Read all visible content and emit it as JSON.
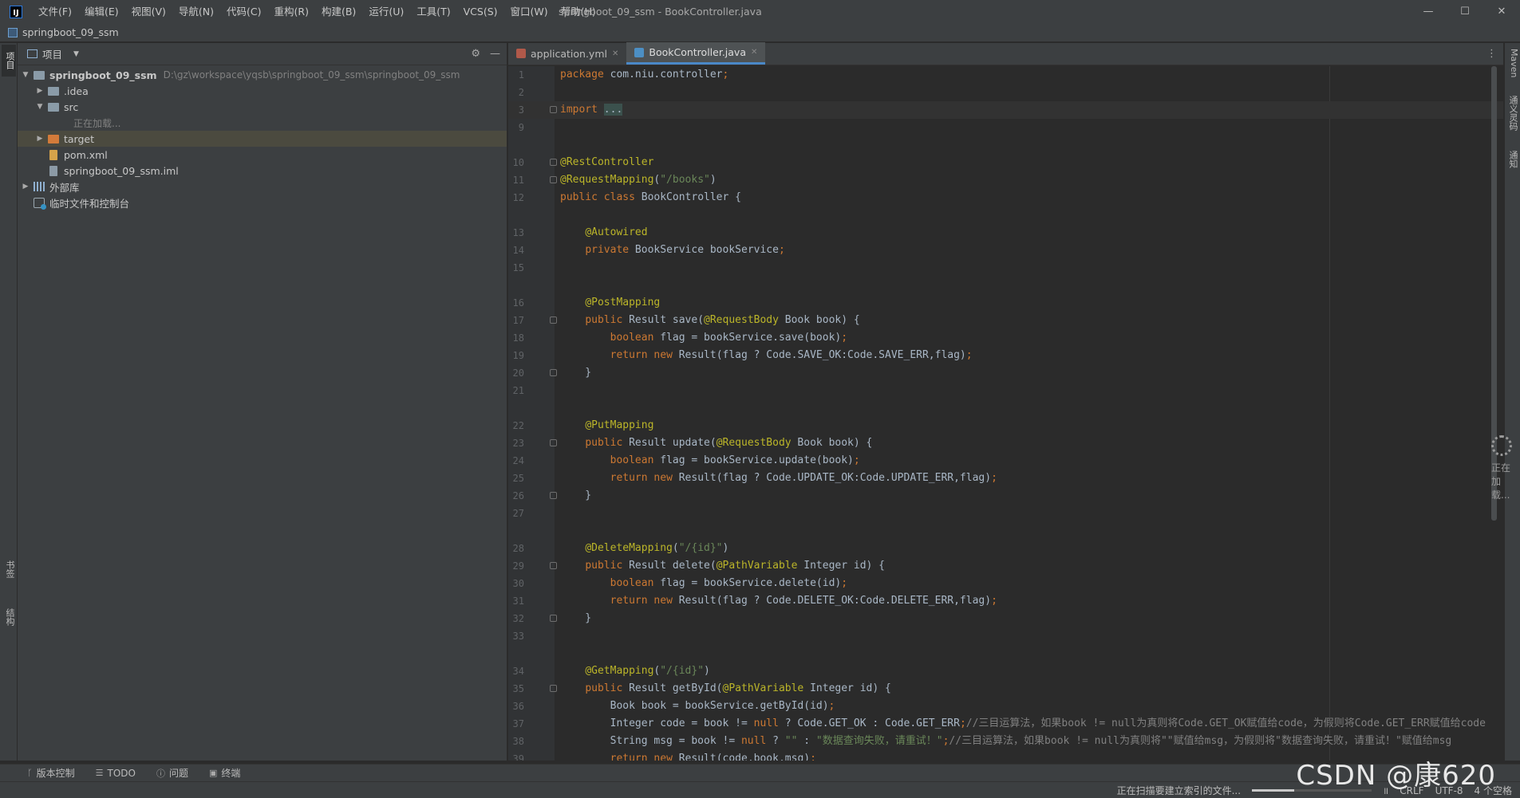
{
  "window": {
    "title": "springboot_09_ssm - BookController.java",
    "logo": "IJ",
    "menu": [
      "文件(F)",
      "编辑(E)",
      "视图(V)",
      "导航(N)",
      "代码(C)",
      "重构(R)",
      "构建(B)",
      "运行(U)",
      "工具(T)",
      "VCS(S)",
      "窗口(W)",
      "帮助(H)"
    ],
    "minimize": "—",
    "maximize": "☐",
    "close": "✕"
  },
  "navbar": {
    "project": "springboot_09_ssm"
  },
  "left_strip": {
    "project_tab": "项目",
    "bookmarks_tab": "书签",
    "structure_tab": "结构"
  },
  "right_strip": {
    "maven_tab": "Maven",
    "database_tab": "通义灵码",
    "notifications_tab": "通知"
  },
  "project_panel": {
    "title": "项目",
    "tree": [
      {
        "label": "springboot_09_ssm",
        "hint": "D:\\gz\\workspace\\yqsb\\springboot_09_ssm\\springboot_09_ssm"
      },
      {
        "label": ".idea"
      },
      {
        "label": "src"
      },
      {
        "label": "正在加载..."
      },
      {
        "label": "target"
      },
      {
        "label": "pom.xml"
      },
      {
        "label": "springboot_09_ssm.iml"
      },
      {
        "label": "外部库"
      },
      {
        "label": "临时文件和控制台"
      }
    ]
  },
  "editor": {
    "tabs": [
      {
        "label": "application.yml"
      },
      {
        "label": "BookController.java"
      }
    ],
    "line_numbers": [
      "1",
      "2",
      "3",
      "9",
      "10",
      "11",
      "12",
      "13",
      "14",
      "15",
      "16",
      "17",
      "18",
      "19",
      "20",
      "21",
      "22",
      "23",
      "24",
      "25",
      "26",
      "27",
      "28",
      "29",
      "30",
      "31",
      "32",
      "33",
      "34",
      "35",
      "36",
      "37",
      "38",
      "39"
    ],
    "loading_text": "正在加载..."
  },
  "bottom_bar": {
    "vcs": "版本控制",
    "todo": "TODO",
    "problems": "问题",
    "terminal": "终端"
  },
  "status_bar": {
    "indexing": "正在扫描要建立索引的文件...",
    "indexing_progress": 0.35,
    "line_sep": "CRLF",
    "encoding": "UTF-8",
    "indent": "4 个空格"
  },
  "watermark": "CSDN @康620",
  "colors": {
    "keyword": "#cc7832",
    "annotation": "#bbb529",
    "string": "#6a8759",
    "comment": "#808080",
    "text": "#a9b7c6"
  }
}
